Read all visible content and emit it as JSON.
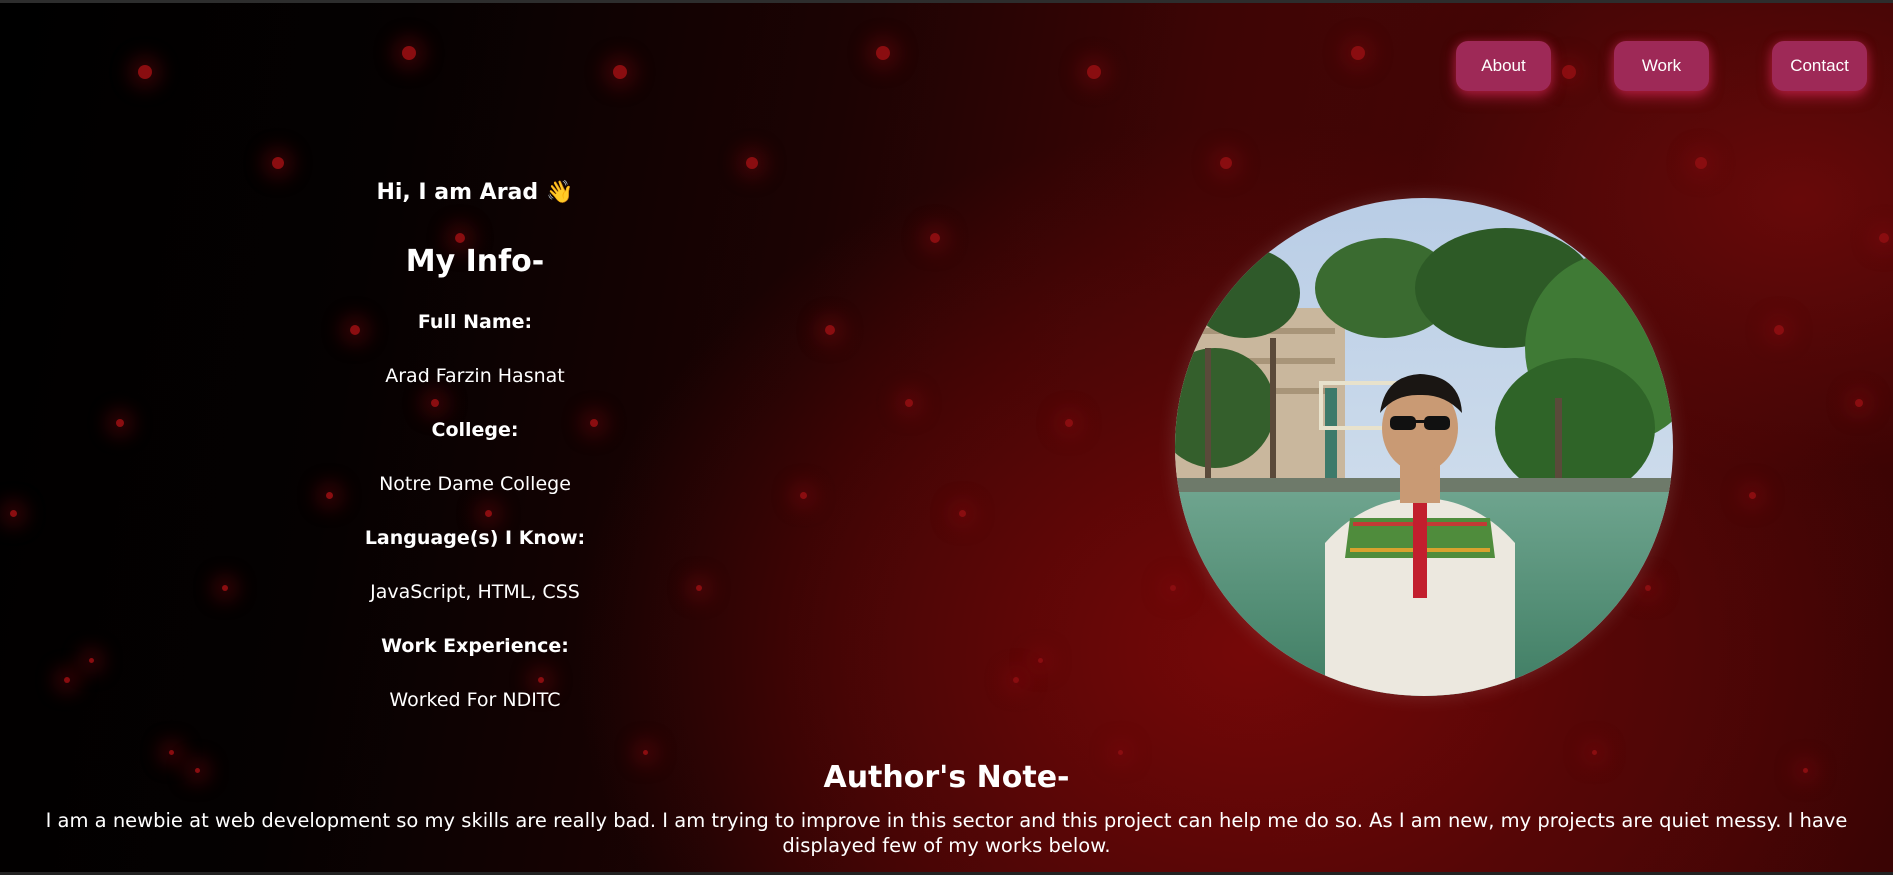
{
  "nav": {
    "about": "About",
    "work": "Work",
    "contact": "Contact"
  },
  "info": {
    "greeting": "Hi, I am Arad",
    "wave_emoji": "👋",
    "title": "My Info-",
    "full_name_label": "Full Name:",
    "full_name": "Arad Farzin Hasnat",
    "college_label": "College:",
    "college": "Notre Dame College",
    "languages_label": "Language(s) I Know:",
    "languages": "JavaScript, HTML, CSS",
    "work_label": "Work Experience:",
    "work": "Worked For NDITC"
  },
  "note": {
    "title": "Author's Note-",
    "body": "I am a newbie at web development so my skills are really bad. I am trying to improve in this sector and this project can help me do so. As I am new, my projects are quiet messy. I have displayed few of my works below."
  },
  "colors": {
    "button": "#9e2957",
    "accent_red": "#8a0d10"
  }
}
